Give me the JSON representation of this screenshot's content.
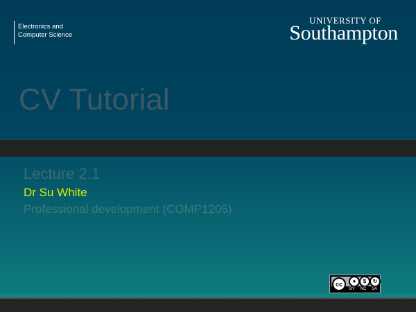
{
  "header": {
    "department_line1": "Electronics and",
    "department_line2": "Computer Science",
    "university_small": "UNIVERSITY OF",
    "university_big": "Southampton"
  },
  "slide": {
    "title": "CV Tutorial",
    "lecture": "Lecture 2.1",
    "presenter": "Dr Su White",
    "course": "Professional development (COMP1205)"
  },
  "license": {
    "cc_mark": "cc",
    "labels": [
      "BY",
      "NC",
      "SA"
    ]
  },
  "colors": {
    "background_top": "#003c58",
    "background_bottom": "#14888a",
    "presenter_accent": "#d6f000",
    "divider": "#222222"
  }
}
